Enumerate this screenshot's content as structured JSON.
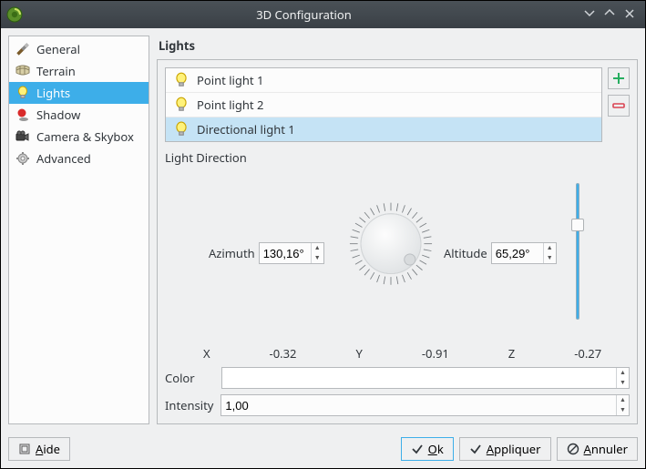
{
  "window": {
    "title": "3D Configuration"
  },
  "sidebar": {
    "items": [
      {
        "label": "General"
      },
      {
        "label": "Terrain"
      },
      {
        "label": "Lights"
      },
      {
        "label": "Shadow"
      },
      {
        "label": "Camera & Skybox"
      },
      {
        "label": "Advanced"
      }
    ],
    "selected_index": 2
  },
  "panel": {
    "title": "Lights",
    "lights": [
      {
        "label": "Point light 1"
      },
      {
        "label": "Point light 2"
      },
      {
        "label": "Directional light 1"
      }
    ],
    "selected_light_index": 2,
    "direction_label": "Light Direction",
    "azimuth_label": "Azimuth",
    "azimuth_value": "130,16°",
    "altitude_label": "Altitude",
    "altitude_value": "65,29°",
    "x_label": "X",
    "x_value": "-0.32",
    "y_label": "Y",
    "y_value": "-0.91",
    "z_label": "Z",
    "z_value": "-0.27",
    "color_label": "Color",
    "color_value": "#ffffff",
    "intensity_label": "Intensity",
    "intensity_value": "1,00"
  },
  "buttons": {
    "help": "Aide",
    "ok": "Ok",
    "apply": "Appliquer",
    "cancel": "Annuler"
  }
}
